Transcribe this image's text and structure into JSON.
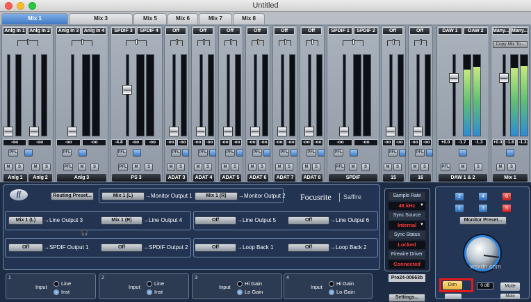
{
  "window": {
    "title": "Untitled"
  },
  "tabs": [
    "Mix 1",
    "Mix 3",
    "Mix 5",
    "Mix 6",
    "Mix 7",
    "Mix 8"
  ],
  "strips": [
    {
      "sources": [
        "Anlg In 1",
        "Anlg In 2"
      ],
      "values": [
        "-oo",
        "-oo"
      ],
      "pfl": "PFL",
      "mute": "M",
      "solo": "S",
      "name1": "Anlg 1",
      "name2": "Anlg 2",
      "levels": [
        0,
        0
      ],
      "fader": 0.0
    },
    {
      "sources": [
        "Anlg In 3",
        "Anlg In 4"
      ],
      "values": [
        "-oo",
        "-oo"
      ],
      "pfl": "PFL",
      "mute": "M",
      "solo": "S",
      "name": "Anlg 3",
      "levels": [
        0,
        0
      ],
      "fader": 0.0
    },
    {
      "sources": [
        "SPDIF 3",
        "SPDIF 4"
      ],
      "values": [
        "-4.8",
        "-oo",
        "-oo"
      ],
      "pfl": "PFL",
      "mute": "M",
      "solo": "S",
      "name": "PS 3",
      "levels": [
        0,
        0
      ],
      "fader": 0.6
    },
    {
      "sources": [
        "Off"
      ],
      "values": [
        "-oo",
        "-oo"
      ],
      "pfl": "PFL",
      "mute": "M",
      "solo": "S",
      "name": "ADAT 3"
    },
    {
      "sources": [
        "Off"
      ],
      "values": [
        "-oo",
        "-oo"
      ],
      "pfl": "PFL",
      "mute": "M",
      "solo": "S",
      "name": "ADAT 4"
    },
    {
      "sources": [
        "Off"
      ],
      "values": [
        "-oo",
        "-oo"
      ],
      "pfl": "PFL",
      "mute": "M",
      "solo": "S",
      "name": "ADAT 5"
    },
    {
      "sources": [
        "Off"
      ],
      "values": [
        "-oo",
        "-oo"
      ],
      "pfl": "PFL",
      "mute": "M",
      "solo": "S",
      "name": "ADAT 6"
    },
    {
      "sources": [
        "Off"
      ],
      "values": [
        "-oo",
        "-oo"
      ],
      "pfl": "PFL",
      "mute": "M",
      "solo": "S",
      "name": "ADAT 7"
    },
    {
      "sources": [
        "Off"
      ],
      "values": [
        "-oo",
        "-oo"
      ],
      "pfl": "PFL",
      "mute": "M",
      "solo": "S",
      "name": "ADAT 8"
    },
    {
      "sources": [
        "SPDIF 1",
        "SPDIF 2"
      ],
      "values": [
        "-oo",
        "-oo"
      ],
      "pfl": "PFL",
      "mute": "M",
      "solo": "S",
      "name": "SPDIF"
    },
    {
      "sources": [
        "Off"
      ],
      "values": [
        "-oo",
        "-oo"
      ],
      "pfl": "PFL",
      "mute": "M",
      "solo": "S",
      "name": "15"
    },
    {
      "sources": [
        "Off"
      ],
      "values": [
        "-oo",
        "-oo"
      ],
      "pfl": "PFL",
      "mute": "M",
      "solo": "S",
      "name": "16"
    },
    {
      "sources": [
        "DAW 1",
        "DAW 2"
      ],
      "values": [
        "+0.0",
        "-1.7",
        "-1.3"
      ],
      "pfl": "PFL",
      "mute": "M",
      "solo": "S",
      "name": "DAW 1 & 2",
      "levels": [
        0.82,
        0.85
      ],
      "fader": 0.77
    },
    {
      "sources": [
        "Many...",
        "Many..."
      ],
      "values": [
        "+0.0",
        "-1.8",
        "-1.3"
      ],
      "mute": "M",
      "solo": "S",
      "name": "Mix 1",
      "copy": "Copy Mix To...",
      "levels": [
        0.84,
        0.86
      ],
      "fader": 0.77
    }
  ],
  "routing": {
    "logo_text": "ff",
    "preset_button": "Routing Preset...",
    "brand": "Focusrite",
    "product": "Saffire",
    "rows": [
      [
        {
          "src": "Mix 1 (L)",
          "dest": "Monitor Output 1"
        },
        {
          "src": "Mix 1 (R)",
          "dest": "Monitor Output 2"
        }
      ],
      [
        {
          "src": "Mix 1 (L)",
          "dest": "Line Output 3"
        },
        {
          "src": "Mix 1 (R)",
          "dest": "Line Output 4"
        },
        {
          "src": "Off",
          "dest": "Line Output 5"
        },
        {
          "src": "Off",
          "dest": "Line Output 6"
        }
      ],
      [
        {
          "src": "Off",
          "dest": "SPDIF Output 1"
        },
        {
          "src": "Off",
          "dest": "SPDIF Output 2"
        },
        {
          "src": "Off",
          "dest": "Loop Back 1"
        },
        {
          "src": "Off",
          "dest": "Loop Back 2"
        }
      ]
    ]
  },
  "status": {
    "sample_rate_label": "Sample Rate",
    "sample_rate": "48 kHz",
    "sync_source_label": "Sync Source",
    "sync_source": "Internal",
    "sync_status_label": "Sync Status",
    "sync_status": "Locked",
    "firewire_label": "Firewire Driver",
    "firewire": "Connected",
    "device": "Pro24-00663b",
    "settings": "Settings..."
  },
  "monitor": {
    "buttons": [
      "2",
      "4",
      "6",
      "1",
      "3",
      "5"
    ],
    "preset": "Monitor Preset...",
    "dim": "Dim",
    "db": "0 dB",
    "mute": "Mute",
    "mute2": "Mute",
    "level": 0.86
  },
  "inputs": [
    {
      "num": "1",
      "label": "Input",
      "opt1": "Line",
      "opt2": "Inst"
    },
    {
      "num": "2",
      "label": "Input",
      "opt1": "Line",
      "opt2": "Inst"
    },
    {
      "num": "3",
      "label": "Input",
      "opt1": "Hi Gain",
      "opt2": "Lo Gain"
    },
    {
      "num": "4",
      "label": "Input",
      "opt1": "Hi Gain",
      "opt2": "Lo Gain"
    }
  ],
  "watermark": "wsxdn.com",
  "colors": {
    "accent": "#3f78c2",
    "status_red": "#ff3d3d",
    "highlight": "#ff2a2a"
  }
}
